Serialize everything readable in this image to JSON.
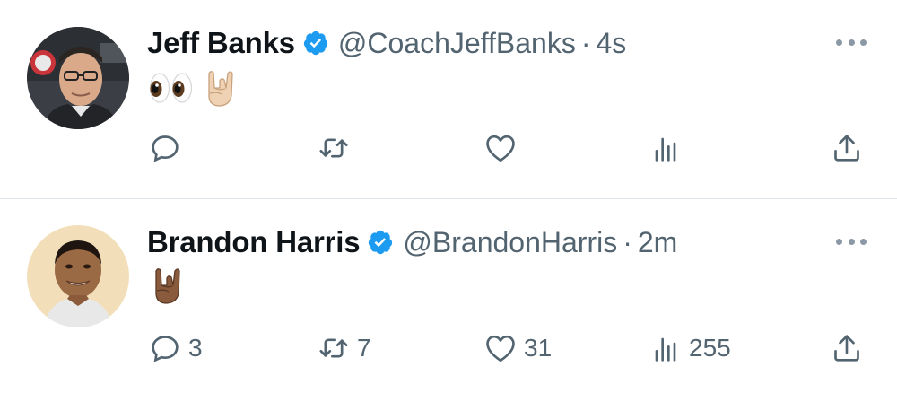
{
  "tweets": [
    {
      "name": "Jeff Banks",
      "handle": "@CoachJeffBanks",
      "separator": "·",
      "time": "4s",
      "verified": true,
      "body_emoji": [
        "eyes",
        "sign-of-the-horns-light-skin"
      ],
      "counts": {
        "reply": "",
        "retweet": "",
        "like": "",
        "views": ""
      }
    },
    {
      "name": "Brandon Harris",
      "handle": "@BrandonHarris",
      "separator": "·",
      "time": "2m",
      "verified": true,
      "body_emoji": [
        "sign-of-the-horns-dark-skin"
      ],
      "counts": {
        "reply": "3",
        "retweet": "7",
        "like": "31",
        "views": "255"
      }
    }
  ],
  "colors": {
    "verified_blue": "#1d9bf0",
    "secondary_text": "#536471",
    "icon_gray": "#536471",
    "divider": "#e1e6ea"
  },
  "icons": [
    "more-icon",
    "reply-icon",
    "retweet-icon",
    "like-icon",
    "views-icon",
    "share-icon",
    "verified-badge-icon"
  ]
}
